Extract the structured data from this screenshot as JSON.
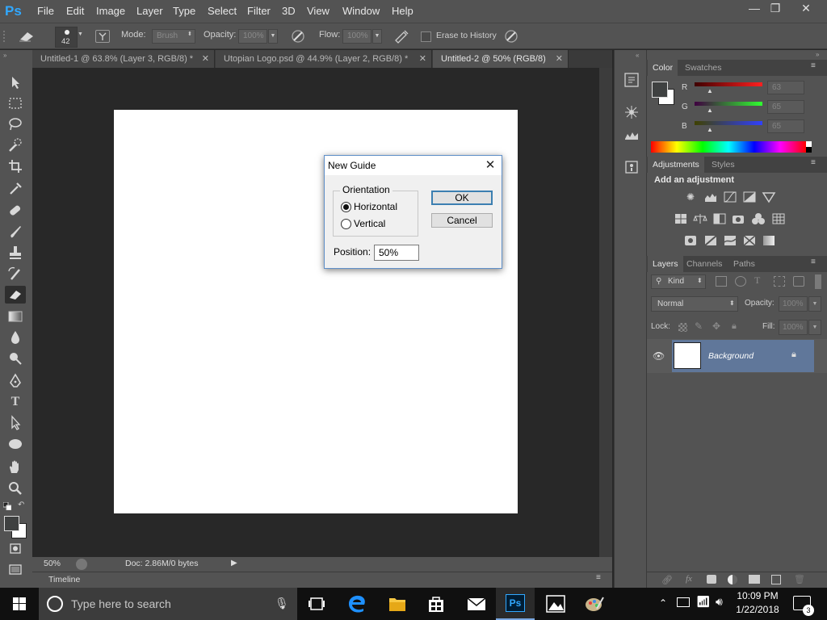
{
  "app": {
    "logo": "Ps"
  },
  "menus": [
    "File",
    "Edit",
    "Image",
    "Layer",
    "Type",
    "Select",
    "Filter",
    "3D",
    "View",
    "Window",
    "Help"
  ],
  "window_controls": {
    "minimize": "—",
    "restore": "❐",
    "close": "✕"
  },
  "options": {
    "brush_size": "42",
    "mode_label": "Mode:",
    "mode_value": "Brush",
    "opacity_label": "Opacity:",
    "opacity_value": "100%",
    "flow_label": "Flow:",
    "flow_value": "100%",
    "erase_history_label": "Erase to History"
  },
  "tabs": [
    {
      "label": "Untitled-1 @ 63.8% (Layer 3, RGB/8) *",
      "active": false
    },
    {
      "label": "Utopian Logo.psd @ 44.9% (Layer 2, RGB/8) *",
      "active": false
    },
    {
      "label": "Untitled-2 @ 50% (RGB/8)",
      "active": true
    }
  ],
  "status": {
    "zoom": "50%",
    "doc_info": "Doc: 2.86M/0 bytes"
  },
  "timeline_label": "Timeline",
  "color_panel": {
    "tabs": [
      "Color",
      "Swatches"
    ],
    "channels": [
      {
        "label": "R",
        "value": "63",
        "color": "#d24848"
      },
      {
        "label": "G",
        "value": "65",
        "color": "#3cb44a"
      },
      {
        "label": "B",
        "value": "65",
        "color": "#4a62d2"
      }
    ]
  },
  "adjustments_panel": {
    "tabs": [
      "Adjustments",
      "Styles"
    ],
    "heading": "Add an adjustment"
  },
  "layers_panel": {
    "tabs": [
      "Layers",
      "Channels",
      "Paths"
    ],
    "kind_label": "Kind",
    "blend_mode": "Normal",
    "opacity_label": "Opacity:",
    "opacity_value": "100%",
    "lock_label": "Lock:",
    "fill_label": "Fill:",
    "fill_value": "100%",
    "layers": [
      {
        "name": "Background"
      }
    ]
  },
  "dialog": {
    "title": "New Guide",
    "group_label": "Orientation",
    "options": [
      "Horizontal",
      "Vertical"
    ],
    "selected": "Horizontal",
    "position_label": "Position:",
    "position_value": "50%",
    "ok_label": "OK",
    "cancel_label": "Cancel"
  },
  "taskbar": {
    "search_placeholder": "Type here to search",
    "time": "10:09 PM",
    "date": "1/22/2018",
    "notification_count": "3",
    "ps_label": "Ps"
  }
}
